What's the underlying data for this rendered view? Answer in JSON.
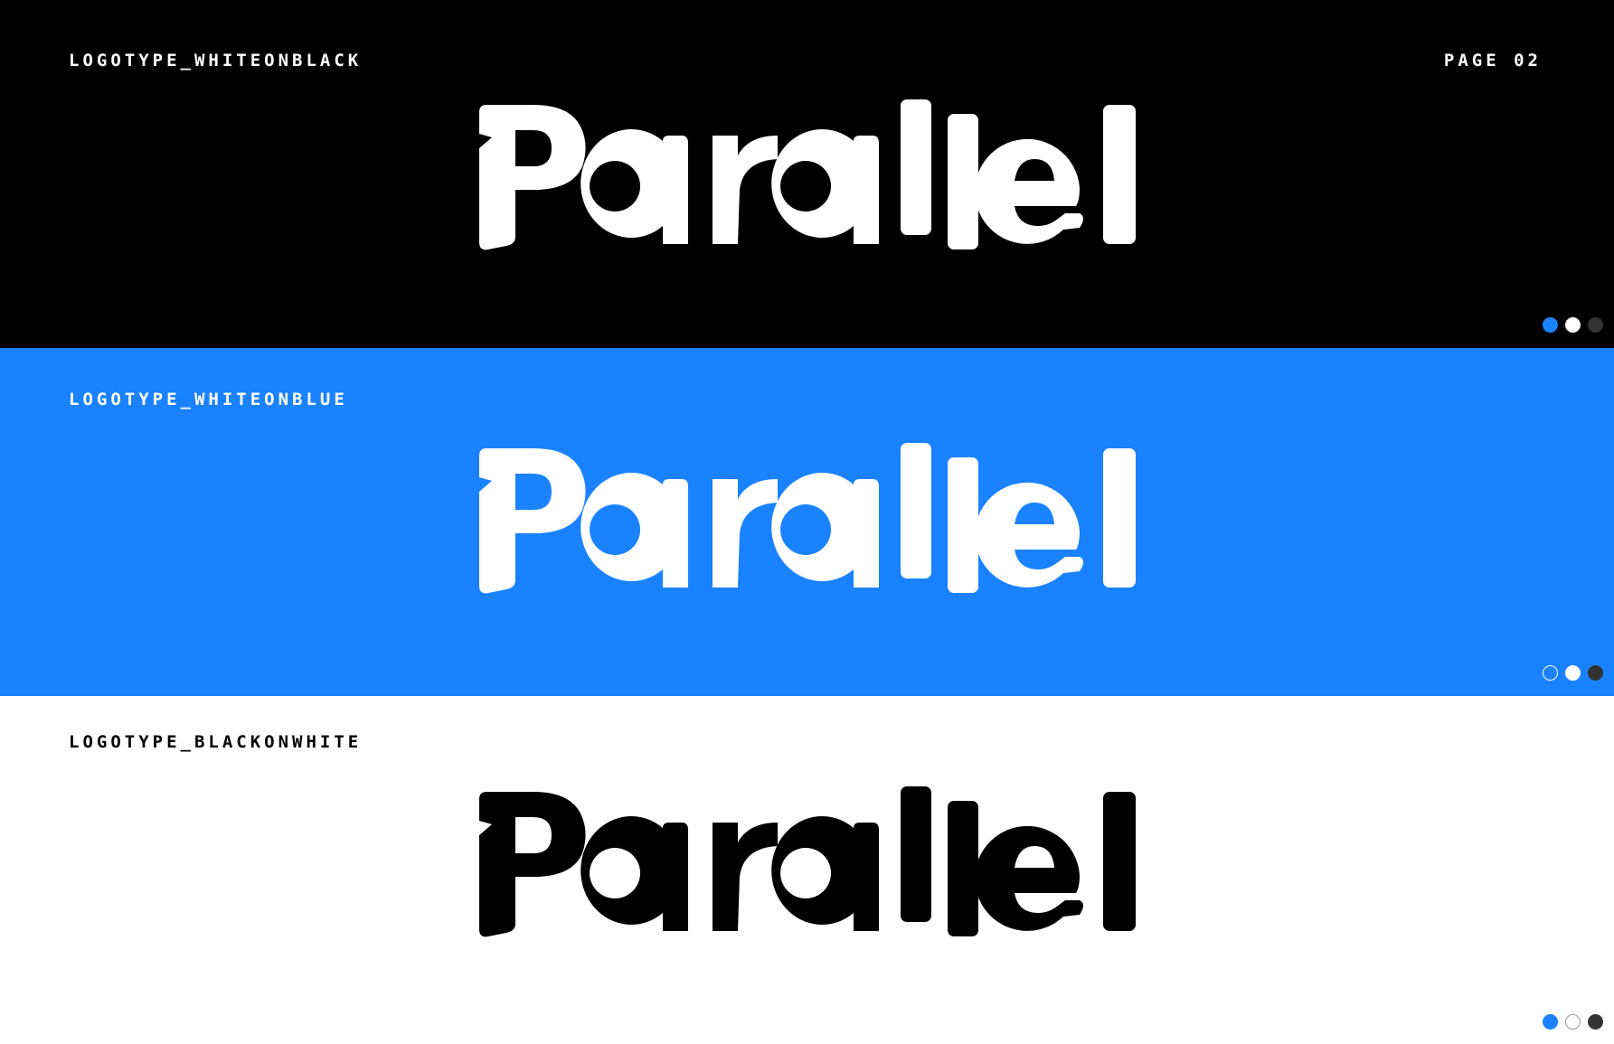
{
  "page_label": "PAGE 02",
  "brand": {
    "name": "Parallel",
    "black": "#000000",
    "blue": "#1a82ff",
    "white": "#ffffff",
    "dark_grey": "#333333"
  },
  "panels": [
    {
      "label": "LOGOTYPE_WHITEONBLACK",
      "background": "#000000",
      "logo_color": "#ffffff",
      "swatches": [
        "blue",
        "white",
        "dark-grey"
      ]
    },
    {
      "label": "LOGOTYPE_WHITEONBLUE",
      "background": "#1a82ff",
      "logo_color": "#ffffff",
      "swatches": [
        "blue (outlined)",
        "white",
        "dark-grey"
      ]
    },
    {
      "label": "LOGOTYPE_BLACKONWHITE",
      "background": "#ffffff",
      "logo_color": "#000000",
      "swatches": [
        "blue",
        "white (outlined)",
        "dark-grey"
      ]
    }
  ]
}
